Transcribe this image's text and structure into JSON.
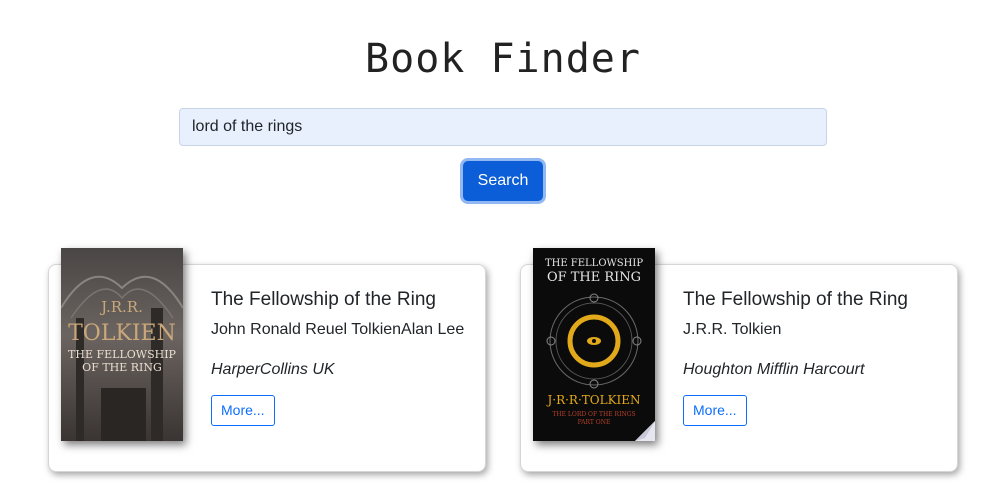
{
  "app": {
    "title": "Book Finder"
  },
  "search": {
    "value": "lord of the rings",
    "placeholder": "",
    "button_label": "Search"
  },
  "results": [
    {
      "title": "The Fellowship of the Ring",
      "author": "John Ronald Reuel TolkienAlan Lee",
      "publisher": "HarperCollins UK",
      "more_label": "More...",
      "cover": {
        "author_text": "J.R.R.",
        "surname_text": "TOLKIEN",
        "title_line1": "THE FELLOWSHIP",
        "title_line2": "OF THE RING"
      }
    },
    {
      "title": "The Fellowship of the Ring",
      "author": "J.R.R. Tolkien",
      "publisher": "Houghton Mifflin Harcourt",
      "more_label": "More...",
      "cover": {
        "title_line1": "THE FELLOWSHIP",
        "title_line2": "OF THE RING",
        "author_text": "J·R·R·TOLKIEN",
        "series_line1": "THE LORD OF THE RINGS",
        "series_line2": "PART ONE"
      }
    }
  ],
  "colors": {
    "primary": "#0b5ed7",
    "input_bg": "#e8f0fe",
    "link": "#0d6efd"
  }
}
